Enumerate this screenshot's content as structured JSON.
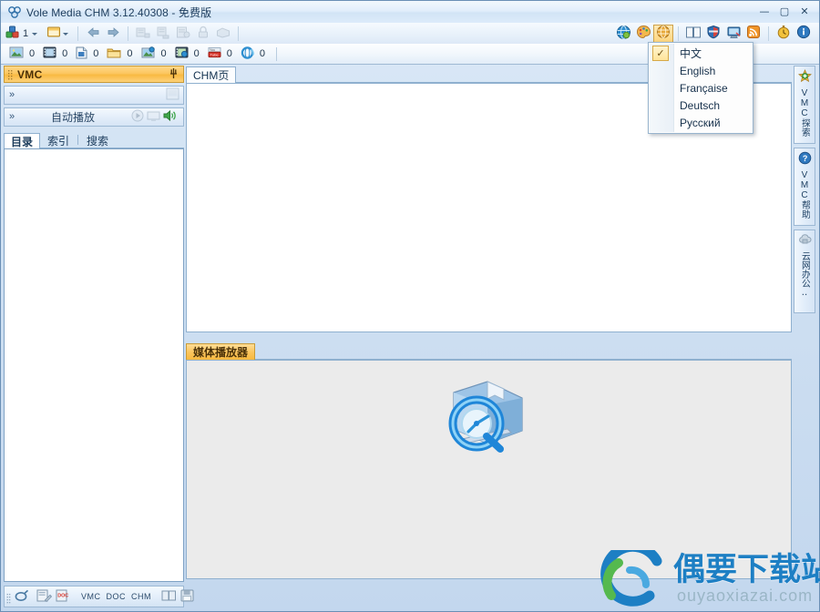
{
  "window": {
    "title": "Vole Media CHM  3.12.40308 - 免费版",
    "app_icon": "vole-logo-icon",
    "minimize_label": "—",
    "maximize_label": "▢",
    "close_label": "✕"
  },
  "toolbar_main": {
    "items": [
      {
        "name": "project-button",
        "icon": "blocks-icon",
        "value": "1",
        "has_caret": true
      },
      {
        "name": "new-page-button",
        "icon": "page-yellow-icon",
        "value": "",
        "has_caret": true
      },
      {
        "name": "back-button",
        "icon": "arrow-left-icon",
        "value": "",
        "has_caret": false
      },
      {
        "name": "forward-button",
        "icon": "arrow-right-icon",
        "value": "",
        "has_caret": false
      },
      {
        "name": "import-button",
        "icon": "import-icon",
        "value": "",
        "has_caret": false
      },
      {
        "name": "export-button",
        "icon": "export-icon",
        "value": "",
        "has_caret": false
      },
      {
        "name": "compile-button",
        "icon": "compile-icon",
        "value": "",
        "has_caret": false
      },
      {
        "name": "lock-button",
        "icon": "lock-icon",
        "value": "",
        "has_caret": false
      },
      {
        "name": "clear-button",
        "icon": "clear-icon",
        "value": "",
        "has_caret": false
      }
    ]
  },
  "toolbar_counters": {
    "items": [
      {
        "name": "counter-image",
        "icon": "image-icon",
        "count": "0"
      },
      {
        "name": "counter-video",
        "icon": "film-icon",
        "count": "0"
      },
      {
        "name": "counter-document",
        "icon": "document-icon",
        "count": "0"
      },
      {
        "name": "counter-folder",
        "icon": "folder-icon",
        "count": "0"
      },
      {
        "name": "counter-photo-link",
        "icon": "photo-link-icon",
        "count": "0"
      },
      {
        "name": "counter-media",
        "icon": "media-icon",
        "count": "0"
      },
      {
        "name": "counter-youtube",
        "icon": "youtube-icon",
        "count": "0"
      },
      {
        "name": "counter-web",
        "icon": "web-icon",
        "count": "0"
      }
    ]
  },
  "left_panel": {
    "header_title": "VMC",
    "pin_icon": "pin-icon",
    "strip1": {
      "chevron": "chevron-down-icon",
      "label": "",
      "button_icon": "panel-icon"
    },
    "strip2": {
      "chevron": "chevron-down-icon",
      "label": "自动播放",
      "play_icon": "play-icon",
      "screen_icon": "screen-icon",
      "sound_icon": "speaker-icon"
    },
    "tabs": [
      {
        "name": "tab-contents",
        "label": "目录",
        "active": true
      },
      {
        "name": "tab-index",
        "label": "索引",
        "active": false
      },
      {
        "name": "tab-search",
        "label": "搜索",
        "active": false
      }
    ],
    "bottom_toolbar": [
      {
        "name": "globe-tool",
        "icon": "globe-icon",
        "label": ""
      },
      {
        "name": "edit-tool",
        "icon": "edit-page-icon",
        "label": ""
      },
      {
        "name": "doc-tool",
        "icon": "doc-stamp-icon",
        "label": ""
      },
      {
        "name": "vmc-tool",
        "icon": "vmc-text-icon",
        "label": "VMC"
      },
      {
        "name": "doc-text-tool",
        "icon": "doc-text-icon",
        "label": "DOC"
      },
      {
        "name": "chm-text-tool",
        "icon": "chm-text-icon",
        "label": "CHM"
      },
      {
        "name": "book-tool",
        "icon": "book-icon",
        "label": ""
      },
      {
        "name": "save-tool",
        "icon": "save-disk-icon",
        "label": ""
      }
    ]
  },
  "center": {
    "document_tab": "CHM页",
    "player_tab": "媒体播放器",
    "player_logo_icon": "quicktime-folder-icon"
  },
  "right_tabs": [
    {
      "name": "vtab-vmc-explore",
      "label": "VMC探索",
      "icon": "star-green-icon"
    },
    {
      "name": "vtab-vmc-help",
      "label": "VMC帮助",
      "icon": "question-blue-icon"
    },
    {
      "name": "vtab-cloud-office",
      "label": "云网办公‥",
      "icon": "cloud-office-icon"
    }
  ],
  "language_menu": {
    "open": true,
    "items": [
      {
        "name": "menu-item-chinese",
        "label": "中文",
        "checked": true
      },
      {
        "name": "menu-item-english",
        "label": "English",
        "checked": false
      },
      {
        "name": "menu-item-french",
        "label": "Française",
        "checked": false
      },
      {
        "name": "menu-item-german",
        "label": "Deutsch",
        "checked": false
      },
      {
        "name": "menu-item-russian",
        "label": "Русский",
        "checked": false
      }
    ],
    "check_glyph": "✓"
  },
  "toolbar_right": {
    "items": [
      {
        "name": "web-preview-button",
        "icon": "globe-blue-icon"
      },
      {
        "name": "theme-button",
        "icon": "palette-icon"
      },
      {
        "name": "language-button",
        "icon": "language-globe-icon",
        "active": true
      },
      {
        "name": "book-view-button",
        "icon": "open-book-icon"
      },
      {
        "name": "shield-button",
        "icon": "shield-icon"
      },
      {
        "name": "monitor-button",
        "icon": "monitor-icon"
      },
      {
        "name": "rss-button",
        "icon": "rss-icon"
      },
      {
        "name": "timer-button",
        "icon": "stopwatch-icon"
      },
      {
        "name": "about-button",
        "icon": "info-icon"
      }
    ]
  },
  "watermark": {
    "title": "偶要下载站",
    "url": "ouyaoxiazai.com",
    "logo_icon": "swirl-logo-icon"
  }
}
